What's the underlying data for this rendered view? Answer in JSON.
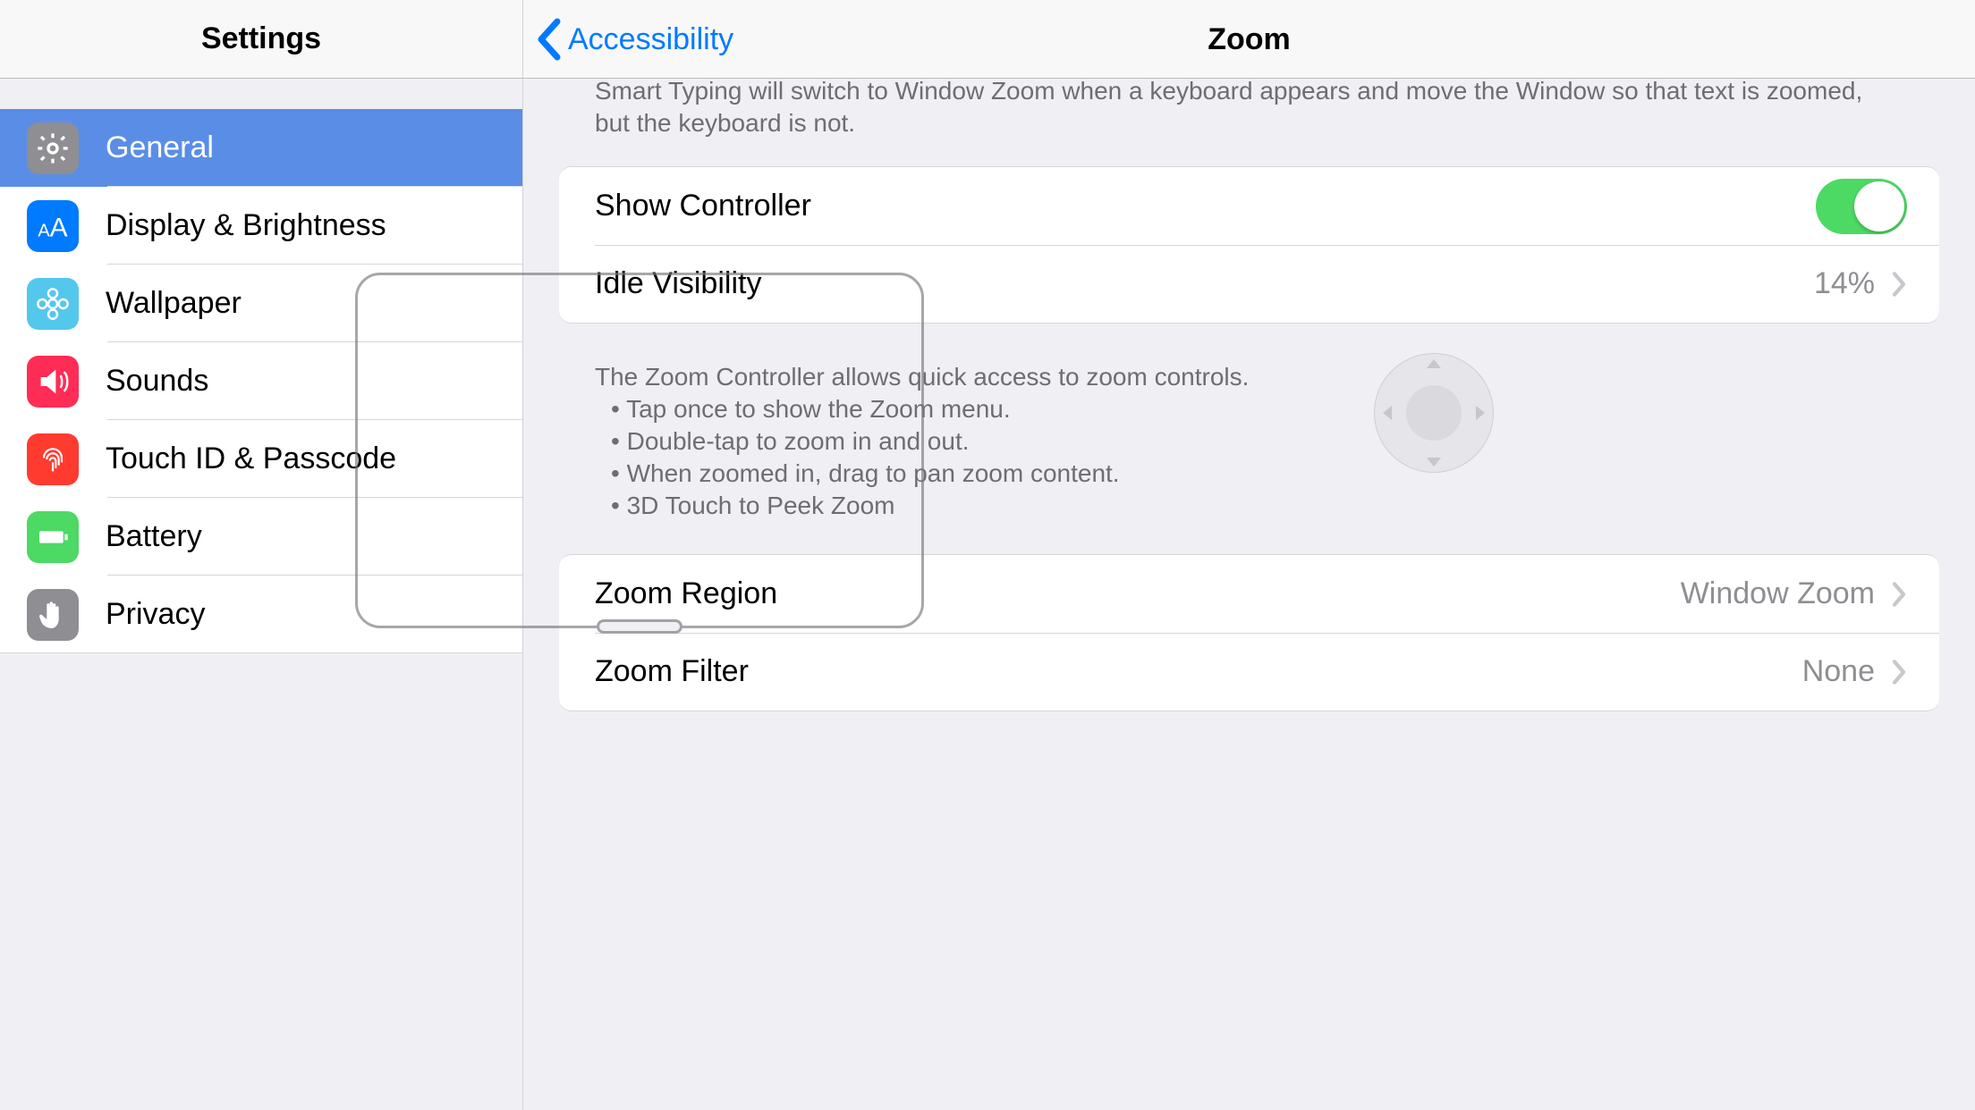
{
  "sidebar": {
    "title": "Settings",
    "items": [
      {
        "key": "general",
        "label": "General"
      },
      {
        "key": "display",
        "label": "Display & Brightness"
      },
      {
        "key": "wallpaper",
        "label": "Wallpaper"
      },
      {
        "key": "sounds",
        "label": "Sounds"
      },
      {
        "key": "touchid",
        "label": "Touch ID & Passcode"
      },
      {
        "key": "battery",
        "label": "Battery"
      },
      {
        "key": "privacy",
        "label": "Privacy"
      }
    ]
  },
  "detail": {
    "back_label": "Accessibility",
    "title": "Zoom",
    "smart_typing_note": "Smart Typing will switch to Window Zoom when a keyboard appears and move the Window so that text is zoomed, but the keyboard is not.",
    "controller_group": {
      "show_controller_label": "Show Controller",
      "show_controller_on": true,
      "idle_visibility_label": "Idle Visibility",
      "idle_visibility_value": "14%"
    },
    "controller_note": {
      "lead": "The Zoom Controller allows quick access to zoom controls.",
      "bullets": [
        "Tap once to show the Zoom menu.",
        "Double-tap to zoom in and out.",
        "When zoomed in, drag to pan zoom content.",
        "3D Touch to Peek Zoom"
      ]
    },
    "region_group": {
      "zoom_region_label": "Zoom Region",
      "zoom_region_value": "Window Zoom",
      "zoom_filter_label": "Zoom Filter",
      "zoom_filter_value": "None"
    }
  }
}
